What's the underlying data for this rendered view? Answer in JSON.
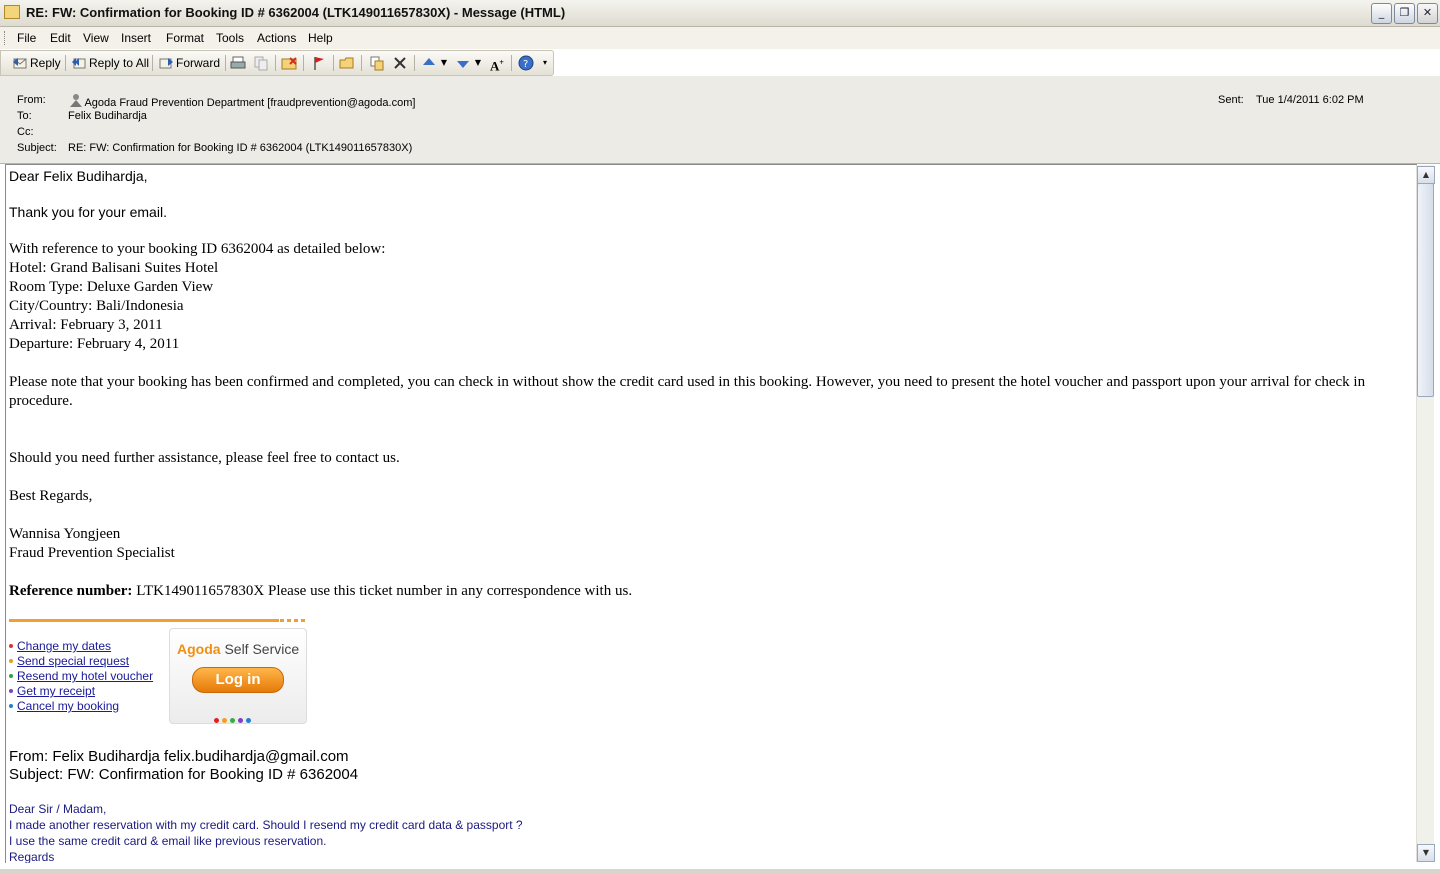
{
  "window": {
    "title": "RE: FW: Confirmation for Booking ID # 6362004 (LTK149011657830X) - Message (HTML)",
    "minimize": "_",
    "restore": "❐",
    "close": "✕"
  },
  "menu": [
    "File",
    "Edit",
    "View",
    "Insert",
    "Format",
    "Tools",
    "Actions",
    "Help"
  ],
  "toolbar": {
    "reply": "Reply",
    "reply_all": "Reply to All",
    "forward": "Forward",
    "icons": [
      "print-icon",
      "copy-icon",
      "move-to-folder-icon",
      "flag-icon",
      "open-folder-icon",
      "move-icon",
      "delete-icon",
      "previous-item-icon",
      "next-item-icon",
      "font-size-icon",
      "help-icon"
    ]
  },
  "header": {
    "from_label": "From:",
    "from": "Agoda Fraud Prevention Department [fraudprevention@agoda.com]",
    "to_label": "To:",
    "to": "Felix Budihardja",
    "cc_label": "Cc:",
    "cc": "",
    "subject_label": "Subject:",
    "subject": "RE: FW: Confirmation for Booking ID # 6362004 (LTK149011657830X)",
    "sent_label": "Sent:",
    "sent": "Tue 1/4/2011 6:02 PM"
  },
  "body": {
    "greeting": "Dear Felix Budihardja,",
    "thanks": "Thank you for your email.",
    "reference_intro": "With reference to your booking ID 6362004 as detailed below:",
    "hotel": "Hotel: Grand Balisani Suites Hotel",
    "room_type": "Room Type: Deluxe Garden View",
    "city": "City/Country: Bali/Indonesia",
    "arrival": "Arrival: February 3, 2011",
    "departure": "Departure: February 4, 2011",
    "note_line1": "Please note that your booking has been confirmed and completed, you can check in without show the credit card used in this booking. However, you need to present the hotel voucher and passport upon your arrival for check in",
    "note_line2": "procedure.",
    "assistance": "Should you need further assistance, please feel free to contact us.",
    "regards": "Best Regards,",
    "signer": "Wannisa Yongjeen",
    "signer_title": "Fraud Prevention Specialist",
    "ref_label": "Reference number:",
    "ref_text": " LTK149011657830X Please use this ticket number in any correspondence with us.",
    "links": [
      {
        "label": "Change my dates",
        "color": "#e03030"
      },
      {
        "label": "Send special request",
        "color": "#e0a020"
      },
      {
        "label": "Resend my hotel voucher",
        "color": "#30a040"
      },
      {
        "label": "Get my receipt",
        "color": "#8040c0"
      },
      {
        "label": "Cancel my booking",
        "color": "#2080d0"
      }
    ],
    "self_service_brand": "Agoda",
    "self_service_label": " Self Service",
    "login_label": "Log in",
    "dot_colors": [
      "#e02020",
      "#f0a020",
      "#30b040",
      "#8040c0",
      "#2080d0"
    ],
    "quoted_from": "From: Felix Budihardja felix.budihardja@gmail.com",
    "quoted_subject": "Subject: FW: Confirmation for Booking ID # 6362004",
    "quoted_greeting": "Dear Sir / Madam,",
    "quoted_line1": "I made another reservation with my credit card. Should I resend my credit card data & passport ?",
    "quoted_line2": "I use the same credit card & email like previous reservation.",
    "quoted_regards": "Regards"
  }
}
